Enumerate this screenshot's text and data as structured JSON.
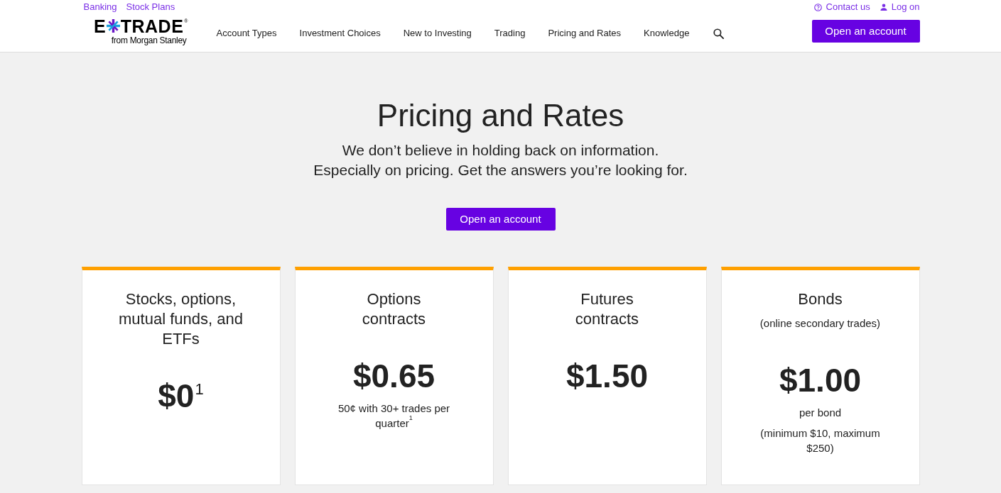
{
  "top_links": {
    "left": [
      {
        "label": "Banking"
      },
      {
        "label": "Stock Plans"
      }
    ],
    "right": [
      {
        "label": "Contact us",
        "kind": "help"
      },
      {
        "label": "Log on",
        "kind": "user"
      }
    ]
  },
  "header": {
    "logo": {
      "letter": "E",
      "word": "TRADE",
      "mark": "®",
      "tagline": "from Morgan Stanley"
    },
    "nav": [
      {
        "label": "Account Types"
      },
      {
        "label": "Investment Choices"
      },
      {
        "label": "New to Investing"
      },
      {
        "label": "Trading"
      },
      {
        "label": "Pricing and Rates"
      },
      {
        "label": "Knowledge"
      }
    ],
    "cta": "Open an account"
  },
  "hero": {
    "title": "Pricing and Rates",
    "subtitle_lines": [
      "We don’t believe in holding back on information.",
      "Especially on pricing. Get the answers you’re looking for."
    ],
    "cta": "Open an account"
  },
  "cards": [
    {
      "title_lines": [
        "Stocks, options,",
        "mutual funds, and",
        "ETFs"
      ],
      "price": "$0$^{1}$"
    },
    {
      "title_lines": [
        "Options",
        "contracts"
      ],
      "price": "$0.65",
      "details": [
        [
          "50¢ with 30+ trades per",
          "quarter$^{1}$"
        ]
      ]
    },
    {
      "title_lines": [
        "Futures",
        "contracts"
      ],
      "price": "$1.50"
    },
    {
      "title_lines": [
        "Bonds"
      ],
      "subtitle": "(online secondary trades)",
      "price": "$1.00",
      "details": [
        [
          "per bond"
        ],
        [
          "(minimum $10, maximum",
          "$250)"
        ]
      ]
    }
  ]
}
